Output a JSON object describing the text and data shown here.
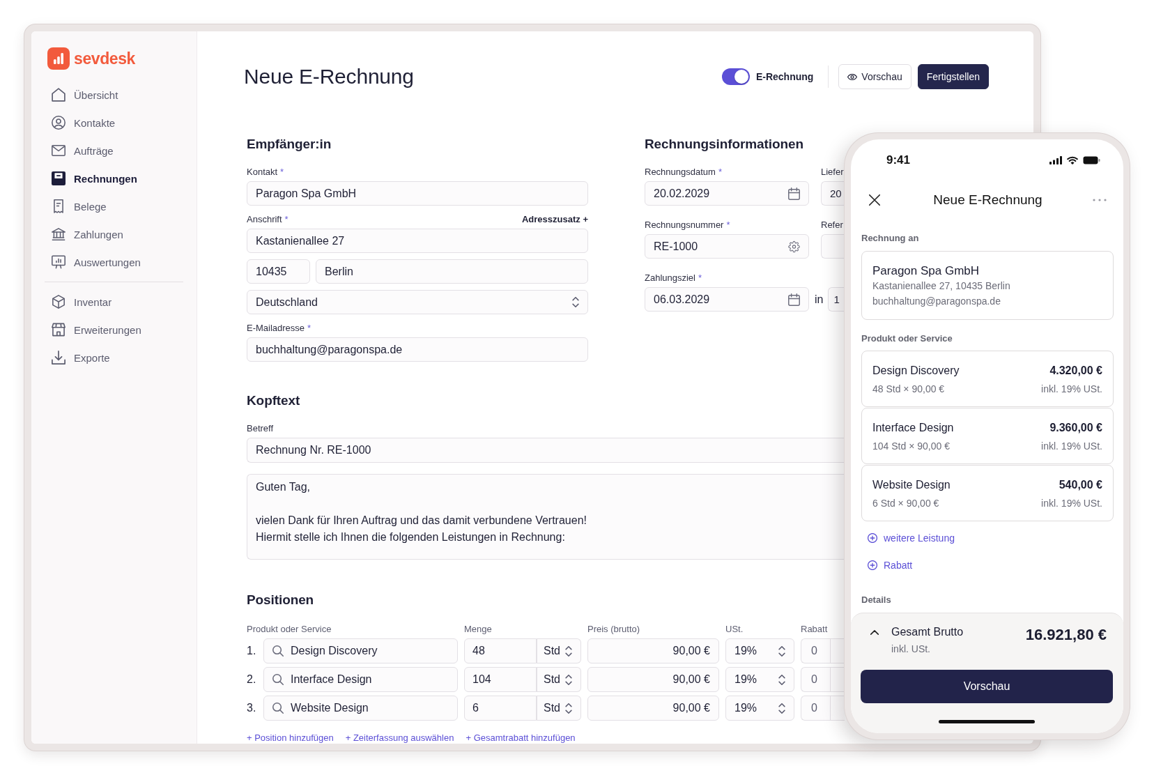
{
  "sidebar": {
    "logo": "sevdesk",
    "groups": [
      {
        "items": [
          {
            "label": "Übersicht",
            "selected": false
          },
          {
            "label": "Kontakte",
            "selected": false
          },
          {
            "label": "Aufträge",
            "selected": false
          },
          {
            "label": "Rechnungen",
            "selected": true
          },
          {
            "label": "Belege",
            "selected": false
          },
          {
            "label": "Zahlungen",
            "selected": false
          },
          {
            "label": "Auswertungen",
            "selected": false
          }
        ]
      },
      {
        "items": [
          {
            "label": "Inventar",
            "selected": false
          },
          {
            "label": "Erweiterungen",
            "selected": false
          },
          {
            "label": "Exporte",
            "selected": false
          }
        ]
      }
    ]
  },
  "header": {
    "title": "Neue E-Rechnung",
    "e_invoice_toggle": {
      "label": "E-Rechnung",
      "on": true
    },
    "buttons": [
      {
        "label": "Vorschau",
        "kind": "secondary"
      },
      {
        "label": "Fertigstellen",
        "kind": "primary"
      }
    ]
  },
  "recipient": {
    "heading": "Empfänger:in",
    "contact": {
      "label": "Kontakt",
      "required_mark": "*",
      "value": "Paragon Spa GmbH"
    },
    "address": {
      "label": "Anschrift",
      "required_mark": "*",
      "extra_link": "Adresszusatz +",
      "street": "Kastanienallee 27",
      "postal_code": "10435",
      "city": "Berlin",
      "country": "Deutschland"
    },
    "email": {
      "label": "E-Mailadresse",
      "required_mark": "*",
      "value": "buchhaltung@paragonspa.de"
    }
  },
  "invoice_info": {
    "heading": "Rechnungsinformationen",
    "rows": [
      {
        "field": {
          "label": "Rechnungsdatum",
          "required_mark": "*",
          "value": "20.02.2029",
          "kind": "date"
        },
        "side": {
          "kind": "field",
          "label": "Liefer",
          "value": "20"
        }
      },
      {
        "field": {
          "label": "Rechnungsnummer",
          "required_mark": "*",
          "value": "RE-1000",
          "kind": "settings"
        },
        "side": {
          "kind": "field",
          "label": "Refer"
        }
      },
      {
        "field": {
          "label": "Zahlungsziel",
          "required_mark": "*",
          "value": "06.03.2029",
          "kind": "date"
        },
        "side": {
          "kind": "days",
          "prefix": "in",
          "value": "1"
        }
      }
    ]
  },
  "intro_text": {
    "heading": "Kopftext",
    "subject": {
      "label": "Betreff",
      "value": "Rechnung Nr. RE-1000"
    },
    "body": "Guten Tag,\n\nvielen Dank für Ihren Auftrag und das damit verbundene Vertrauen!\nHiermit stelle ich Ihnen die folgenden Leistungen in Rechnung:"
  },
  "positions": {
    "heading": "Positionen",
    "columns": [
      "Produkt oder Service",
      "Menge",
      "Preis (brutto)",
      "USt.",
      "Rabatt"
    ],
    "rows": [
      {
        "number": "1.",
        "product": "Design Discovery",
        "quantity": "48",
        "unit": "Std",
        "price": "90,00 €",
        "vat": "19%",
        "discount": "0"
      },
      {
        "number": "2.",
        "product": "Interface Design",
        "quantity": "104",
        "unit": "Std",
        "price": "90,00 €",
        "vat": "19%",
        "discount": "0"
      },
      {
        "number": "3.",
        "product": "Website Design",
        "quantity": "6",
        "unit": "Std",
        "price": "90,00 €",
        "vat": "19%",
        "discount": "0"
      }
    ],
    "actions": [
      "+ Position hinzufügen",
      "+ Zeiterfassung auswählen",
      "+ Gesamtrabatt hinzufügen"
    ]
  },
  "mobile_preview": {
    "time": "9:41",
    "title": "Neue E-Rechnung",
    "recipient": {
      "label": "Rechnung an",
      "name": "Paragon Spa GmbH",
      "address": "Kastanienallee 27, 10435 Berlin",
      "email": "buchhaltung@paragonspa.de"
    },
    "items_label": "Produkt oder Service",
    "items": [
      {
        "name": "Design Discovery",
        "detail": "48 Std × 90,00 €",
        "amount": "4.320,00 €",
        "tax_note": "inkl. 19% USt."
      },
      {
        "name": "Interface Design",
        "detail": "104 Std × 90,00 €",
        "amount": "9.360,00 €",
        "tax_note": "inkl. 19% USt."
      },
      {
        "name": "Website Design",
        "detail": "6 Std × 90,00 €",
        "amount": "540,00 €",
        "tax_note": "inkl. 19% USt."
      }
    ],
    "actions": [
      "weitere Leistung",
      "Rabatt"
    ],
    "details_label": "Details",
    "total": {
      "label": "Gesamt Brutto",
      "note": "inkl. USt.",
      "amount": "16.921,80 €"
    },
    "button": "Vorschau"
  }
}
